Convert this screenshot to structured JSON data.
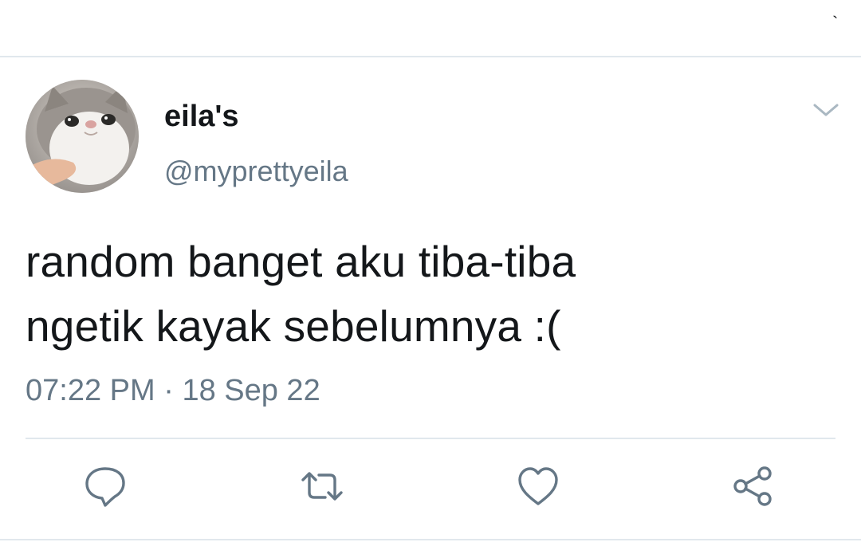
{
  "top_bar": {
    "tick_glyph": "`"
  },
  "author": {
    "display_name": "eila's",
    "handle": "@myprettyeila"
  },
  "tweet": {
    "text_line_1": "random banget aku tiba-tiba",
    "text_line_2": "ngetik kayak sebelumnya :("
  },
  "meta": {
    "time": "07:22 PM",
    "separator": "·",
    "date": "18 Sep 22"
  },
  "actions": [
    {
      "icon": "reply-icon"
    },
    {
      "icon": "retweet-icon"
    },
    {
      "icon": "like-icon"
    },
    {
      "icon": "share-icon"
    }
  ],
  "colors": {
    "icon": "#657786",
    "text": "#14171a",
    "secondary": "#657786",
    "divider": "#e1e8ed"
  }
}
